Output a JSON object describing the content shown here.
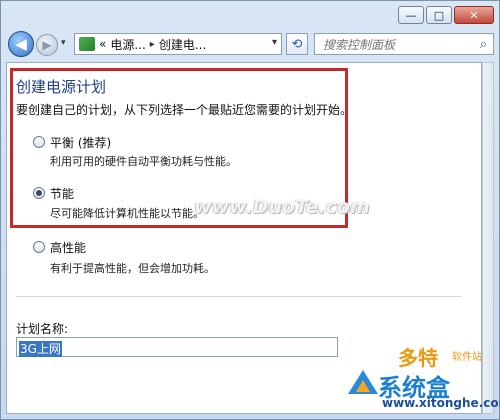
{
  "window": {
    "controls": {
      "minimize": "—",
      "maximize": "□",
      "close": "✕"
    }
  },
  "nav": {
    "back_glyph": "◀",
    "forward_glyph": "▶",
    "dropdown_glyph": "▾",
    "breadcrumb_prefix": "«",
    "breadcrumb": [
      "电源...",
      "创建电..."
    ],
    "breadcrumb_separator": "▸",
    "address_dropdown_glyph": "▾",
    "refresh_glyph": "⟲",
    "search_placeholder": "搜索控制面板",
    "search_icon_glyph": "⌕"
  },
  "page": {
    "title": "创建电源计划",
    "intro": "要创建自己的计划，从下列选择一个最贴近您需要的计划开始。",
    "plans": [
      {
        "label": "平衡 (推荐)",
        "description": "利用可用的硬件自动平衡功耗与性能。",
        "selected": false
      },
      {
        "label": "节能",
        "description": "尽可能降低计算机性能以节能。",
        "selected": true
      },
      {
        "label": "高性能",
        "description": "有利于提高性能，但会增加功耗。",
        "selected": false
      }
    ],
    "plan_name_label": "计划名称:",
    "plan_name_value": "3G上网"
  },
  "watermarks": {
    "duote": "www.DuoTe.com",
    "site_cn": "多特",
    "site_sub": "软件站",
    "xitong": "系统盒",
    "xitong_url": "www.xitonghe.com"
  },
  "colors": {
    "highlight_box": "#c42a2a",
    "title_blue": "#1e3e8f",
    "selection": "#3a76c4"
  }
}
